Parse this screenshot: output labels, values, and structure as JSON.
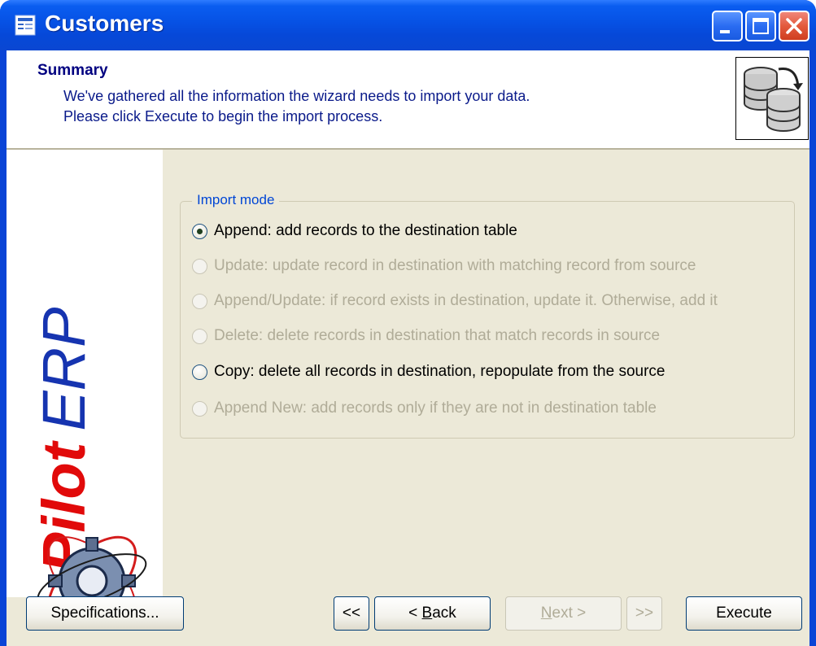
{
  "window": {
    "title": "Customers"
  },
  "header": {
    "title": "Summary",
    "lines": [
      "We've gathered all the information the wizard needs to import your data.",
      "Please click Execute to begin the import process."
    ]
  },
  "logo": {
    "brand": "Pilot",
    "product": "ERP"
  },
  "import_mode": {
    "legend": "Import mode",
    "options": [
      {
        "label": "Append: add records to the destination table",
        "selected": true,
        "enabled": true
      },
      {
        "label": "Update: update record in destination with matching record from source",
        "selected": false,
        "enabled": false
      },
      {
        "label": "Append/Update: if record exists in destination, update it. Otherwise, add it",
        "selected": false,
        "enabled": false
      },
      {
        "label": "Delete: delete records in destination that match records in source",
        "selected": false,
        "enabled": false
      },
      {
        "label": "Copy: delete all records in destination, repopulate from the source",
        "selected": false,
        "enabled": true
      },
      {
        "label": "Append New: add records only if they are not in destination table",
        "selected": false,
        "enabled": false
      }
    ]
  },
  "buttons": {
    "specifications": "Specifications...",
    "first": "<<",
    "back_prefix": "< ",
    "back_mnemonic": "B",
    "back_rest": "ack",
    "next_mnemonic": "N",
    "next_rest": "ext >",
    "last": ">>",
    "execute": "Execute"
  },
  "colors": {
    "titlebar": "#0651e4",
    "client_bg": "#ece9d8",
    "logo_red": "#e10a0a",
    "logo_blue": "#1634b0",
    "disabled_text": "#b0ac98"
  }
}
